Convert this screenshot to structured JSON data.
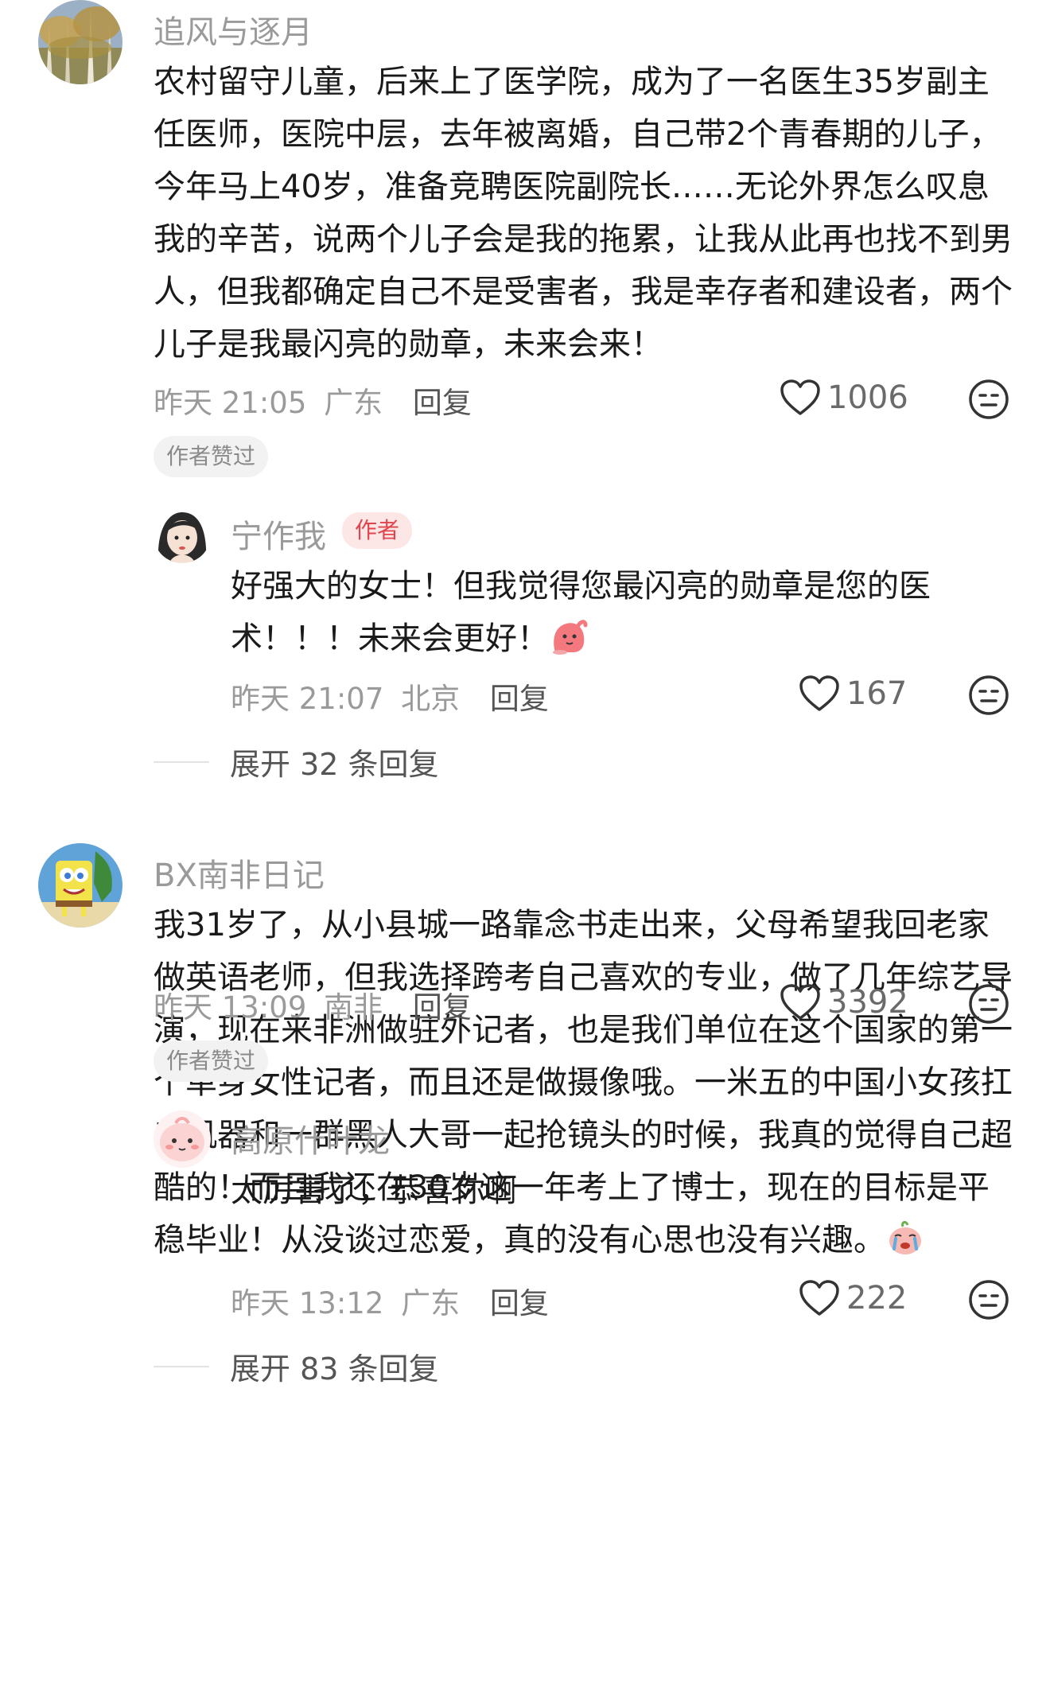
{
  "comments": [
    {
      "username": "追风与逐月",
      "avatar": "landscape-trees-avatar",
      "content": "农村留守儿童，后来上了医学院，成为了一名医生35岁副主任医师，医院中层，去年被离婚，自己带2个青春期的儿子，今年马上40岁，准备竞聘医院副院长……无论外界怎么叹息我的辛苦，说两个儿子会是我的拖累，让我从此再也找不到男人，但我都确定自己不是受害者，我是幸存者和建设者，两个儿子是我最闪亮的勋章，未来会来！",
      "time": "昨天 21:05",
      "location": "广东",
      "reply_label": "回复",
      "likes": "1006",
      "badge": "作者赞过",
      "sub_reply": {
        "username": "宁作我",
        "avatar": "girl-illustration-avatar",
        "author_tag": "作者",
        "content": "好强大的女士！但我觉得您最闪亮的勋章是您的医术！！！未来会更好！",
        "emoji": "pink-blob-emoji",
        "time": "昨天 21:07",
        "location": "北京",
        "reply_label": "回复",
        "likes": "167"
      },
      "expand_label": "展开 32 条回复"
    },
    {
      "username": "BX南非日记",
      "avatar": "spongebob-avatar",
      "content": "我31岁了，从小县城一路靠念书走出来，父母希望我回老家做英语老师，但我选择跨考自己喜欢的专业，做了几年综艺导演，现在来非洲做驻外记者，也是我们单位在这个国家的第一个单身女性记者，而且还是做摄像哦。一米五的中国小女孩扛着机器和一群黑人大哥一起抢镜头的时候，我真的觉得自己超酷的！而且我还在30岁这一年考上了博士，现在的目标是平稳毕业！从没谈过恋爱，真的没有心思也没有兴趣。",
      "emoji": "crying-blob-emoji",
      "time": "昨天 13:09",
      "location": "南非",
      "reply_label": "回复",
      "likes": "3392",
      "badge": "作者赞过",
      "sub_reply": {
        "username": "高原什叶龙",
        "avatar": "pink-blob-avatar",
        "content": "太厉害了，恭喜你啊",
        "time": "昨天 13:12",
        "location": "广东",
        "reply_label": "回复",
        "likes": "222"
      },
      "expand_label": "展开 83 条回复"
    }
  ],
  "colors": {
    "secondary_text": "#9a9a9a",
    "author_tag_bg": "#fde6e6",
    "author_tag_text": "#e0454d",
    "badge_bg": "#f2f2f2"
  },
  "icons": [
    "heart-outline-icon",
    "neutral-face-icon"
  ]
}
